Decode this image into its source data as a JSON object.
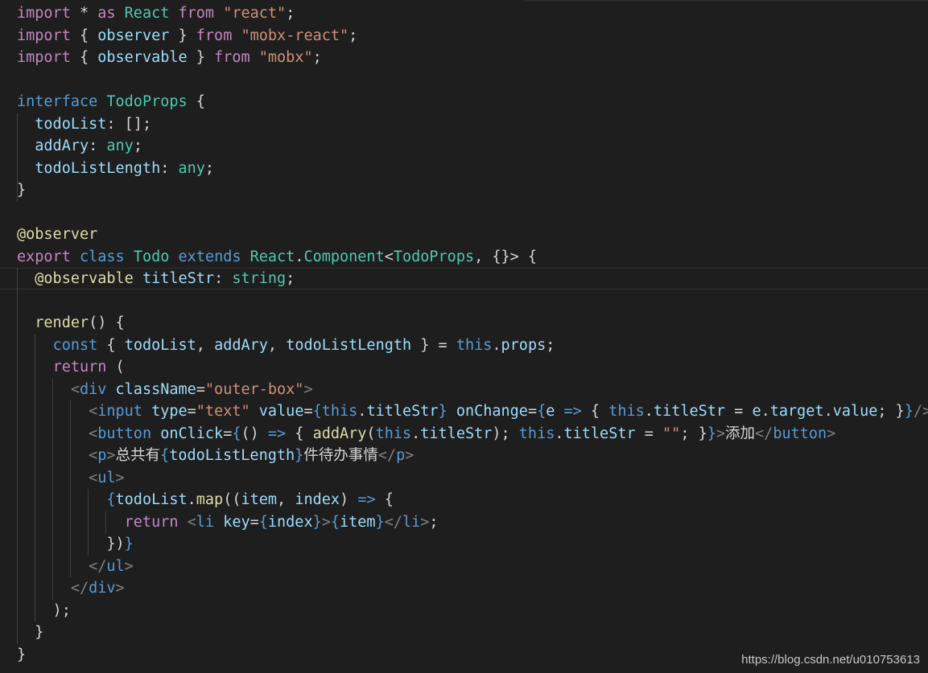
{
  "editor": {
    "theme": "dark",
    "colors": {
      "background": "#1e1e1e",
      "keyword": "#c586c0",
      "storage": "#569cd6",
      "type": "#4ec9b0",
      "string": "#ce9178",
      "variable": "#9cdcfe",
      "function": "#dcdcaa",
      "tag_bracket": "#808080"
    },
    "lines": [
      [
        [
          "kw",
          "import"
        ],
        [
          "pun",
          " * "
        ],
        [
          "kw",
          "as"
        ],
        [
          "pun",
          " "
        ],
        [
          "cls",
          "React"
        ],
        [
          "pun",
          " "
        ],
        [
          "kw",
          "from"
        ],
        [
          "pun",
          " "
        ],
        [
          "str",
          "\"react\""
        ],
        [
          "pun",
          ";"
        ]
      ],
      [
        [
          "kw",
          "import"
        ],
        [
          "pun",
          " { "
        ],
        [
          "var",
          "observer"
        ],
        [
          "pun",
          " } "
        ],
        [
          "kw",
          "from"
        ],
        [
          "pun",
          " "
        ],
        [
          "str",
          "\"mobx-react\""
        ],
        [
          "pun",
          ";"
        ]
      ],
      [
        [
          "kw",
          "import"
        ],
        [
          "pun",
          " { "
        ],
        [
          "var",
          "observable"
        ],
        [
          "pun",
          " } "
        ],
        [
          "kw",
          "from"
        ],
        [
          "pun",
          " "
        ],
        [
          "str",
          "\"mobx\""
        ],
        [
          "pun",
          ";"
        ]
      ],
      [],
      [
        [
          "bl",
          "interface"
        ],
        [
          "pun",
          " "
        ],
        [
          "cls",
          "TodoProps"
        ],
        [
          "pun",
          " {"
        ]
      ],
      [
        [
          "pun",
          "  "
        ],
        [
          "var",
          "todoList"
        ],
        [
          "pun",
          ": [];"
        ]
      ],
      [
        [
          "pun",
          "  "
        ],
        [
          "var",
          "addAry"
        ],
        [
          "pun",
          ": "
        ],
        [
          "cls",
          "any"
        ],
        [
          "pun",
          ";"
        ]
      ],
      [
        [
          "pun",
          "  "
        ],
        [
          "var",
          "todoListLength"
        ],
        [
          "pun",
          ": "
        ],
        [
          "cls",
          "any"
        ],
        [
          "pun",
          ";"
        ]
      ],
      [
        [
          "pun",
          "}"
        ]
      ],
      [],
      [
        [
          "fn",
          "@observer"
        ]
      ],
      [
        [
          "kw",
          "export"
        ],
        [
          "pun",
          " "
        ],
        [
          "bl",
          "class"
        ],
        [
          "pun",
          " "
        ],
        [
          "cls",
          "Todo"
        ],
        [
          "pun",
          " "
        ],
        [
          "bl",
          "extends"
        ],
        [
          "pun",
          " "
        ],
        [
          "cls",
          "React"
        ],
        [
          "pun",
          "."
        ],
        [
          "cls",
          "Component"
        ],
        [
          "pun",
          "<"
        ],
        [
          "cls",
          "TodoProps"
        ],
        [
          "pun",
          ", {}> {"
        ]
      ],
      [
        [
          "pun",
          "  "
        ],
        [
          "fn",
          "@observable"
        ],
        [
          "pun",
          " "
        ],
        [
          "var",
          "titleStr"
        ],
        [
          "pun",
          ": "
        ],
        [
          "cls",
          "string"
        ],
        [
          "pun",
          ";"
        ]
      ],
      [],
      [
        [
          "pun",
          "  "
        ],
        [
          "fn",
          "render"
        ],
        [
          "pun",
          "() {"
        ]
      ],
      [
        [
          "pun",
          "    "
        ],
        [
          "bl",
          "const"
        ],
        [
          "pun",
          " { "
        ],
        [
          "var",
          "todoList"
        ],
        [
          "pun",
          ", "
        ],
        [
          "var",
          "addAry"
        ],
        [
          "pun",
          ", "
        ],
        [
          "var",
          "todoListLength"
        ],
        [
          "pun",
          " } = "
        ],
        [
          "bl",
          "this"
        ],
        [
          "pun",
          "."
        ],
        [
          "var",
          "props"
        ],
        [
          "pun",
          ";"
        ]
      ],
      [
        [
          "pun",
          "    "
        ],
        [
          "kw",
          "return"
        ],
        [
          "pun",
          " ("
        ]
      ],
      [
        [
          "pun",
          "      "
        ],
        [
          "tag",
          "<"
        ],
        [
          "bl",
          "div"
        ],
        [
          "pun",
          " "
        ],
        [
          "var",
          "className"
        ],
        [
          "pun",
          "="
        ],
        [
          "str",
          "\"outer-box\""
        ],
        [
          "tag",
          ">"
        ]
      ],
      [
        [
          "pun",
          "        "
        ],
        [
          "tag",
          "<"
        ],
        [
          "bl",
          "input"
        ],
        [
          "pun",
          " "
        ],
        [
          "var",
          "type"
        ],
        [
          "pun",
          "="
        ],
        [
          "str",
          "\"text\""
        ],
        [
          "pun",
          " "
        ],
        [
          "var",
          "value"
        ],
        [
          "pun",
          "="
        ],
        [
          "brace",
          "{"
        ],
        [
          "bl",
          "this"
        ],
        [
          "pun",
          "."
        ],
        [
          "var",
          "titleStr"
        ],
        [
          "brace",
          "}"
        ],
        [
          "pun",
          " "
        ],
        [
          "var",
          "onChange"
        ],
        [
          "pun",
          "="
        ],
        [
          "brace",
          "{"
        ],
        [
          "var",
          "e"
        ],
        [
          "pun",
          " "
        ],
        [
          "bl",
          "=>"
        ],
        [
          "pun",
          " { "
        ],
        [
          "bl",
          "this"
        ],
        [
          "pun",
          "."
        ],
        [
          "var",
          "titleStr"
        ],
        [
          "pun",
          " = "
        ],
        [
          "var",
          "e"
        ],
        [
          "pun",
          "."
        ],
        [
          "var",
          "target"
        ],
        [
          "pun",
          "."
        ],
        [
          "var",
          "value"
        ],
        [
          "pun",
          "; }"
        ],
        [
          "brace",
          "}"
        ],
        [
          "tag",
          "/>"
        ]
      ],
      [
        [
          "pun",
          "        "
        ],
        [
          "tag",
          "<"
        ],
        [
          "bl",
          "button"
        ],
        [
          "pun",
          " "
        ],
        [
          "var",
          "onClick"
        ],
        [
          "pun",
          "="
        ],
        [
          "brace",
          "{"
        ],
        [
          "pun",
          "() "
        ],
        [
          "bl",
          "=>"
        ],
        [
          "pun",
          " { "
        ],
        [
          "fn",
          "addAry"
        ],
        [
          "pun",
          "("
        ],
        [
          "bl",
          "this"
        ],
        [
          "pun",
          "."
        ],
        [
          "var",
          "titleStr"
        ],
        [
          "pun",
          "); "
        ],
        [
          "bl",
          "this"
        ],
        [
          "pun",
          "."
        ],
        [
          "var",
          "titleStr"
        ],
        [
          "pun",
          " = "
        ],
        [
          "str",
          "\"\""
        ],
        [
          "pun",
          "; }"
        ],
        [
          "brace",
          "}"
        ],
        [
          "tag",
          ">"
        ],
        [
          "cn",
          "添加"
        ],
        [
          "tag",
          "</"
        ],
        [
          "bl",
          "button"
        ],
        [
          "tag",
          ">"
        ]
      ],
      [
        [
          "pun",
          "        "
        ],
        [
          "tag",
          "<"
        ],
        [
          "bl",
          "p"
        ],
        [
          "tag",
          ">"
        ],
        [
          "cn",
          "总共有"
        ],
        [
          "brace",
          "{"
        ],
        [
          "var",
          "todoListLength"
        ],
        [
          "brace",
          "}"
        ],
        [
          "cn",
          "件待办事情"
        ],
        [
          "tag",
          "</"
        ],
        [
          "bl",
          "p"
        ],
        [
          "tag",
          ">"
        ]
      ],
      [
        [
          "pun",
          "        "
        ],
        [
          "tag",
          "<"
        ],
        [
          "bl",
          "ul"
        ],
        [
          "tag",
          ">"
        ]
      ],
      [
        [
          "pun",
          "          "
        ],
        [
          "brace",
          "{"
        ],
        [
          "var",
          "todoList"
        ],
        [
          "pun",
          "."
        ],
        [
          "fn",
          "map"
        ],
        [
          "pun",
          "(("
        ],
        [
          "var",
          "item"
        ],
        [
          "pun",
          ", "
        ],
        [
          "var",
          "index"
        ],
        [
          "pun",
          ") "
        ],
        [
          "bl",
          "=>"
        ],
        [
          "pun",
          " {"
        ]
      ],
      [
        [
          "pun",
          "            "
        ],
        [
          "kw",
          "return"
        ],
        [
          "pun",
          " "
        ],
        [
          "tag",
          "<"
        ],
        [
          "bl",
          "li"
        ],
        [
          "pun",
          " "
        ],
        [
          "var",
          "key"
        ],
        [
          "pun",
          "="
        ],
        [
          "brace",
          "{"
        ],
        [
          "var",
          "index"
        ],
        [
          "brace",
          "}"
        ],
        [
          "tag",
          ">"
        ],
        [
          "brace",
          "{"
        ],
        [
          "var",
          "item"
        ],
        [
          "brace",
          "}"
        ],
        [
          "tag",
          "</"
        ],
        [
          "bl",
          "li"
        ],
        [
          "tag",
          ">"
        ],
        [
          "pun",
          ";"
        ]
      ],
      [
        [
          "pun",
          "          })"
        ],
        [
          "brace",
          "}"
        ]
      ],
      [
        [
          "pun",
          "        "
        ],
        [
          "tag",
          "</"
        ],
        [
          "bl",
          "ul"
        ],
        [
          "tag",
          ">"
        ]
      ],
      [
        [
          "pun",
          "      "
        ],
        [
          "tag",
          "</"
        ],
        [
          "bl",
          "div"
        ],
        [
          "tag",
          ">"
        ]
      ],
      [
        [
          "pun",
          "    );"
        ]
      ],
      [
        [
          "pun",
          "  }"
        ]
      ],
      [
        [
          "pun",
          "}"
        ]
      ]
    ]
  },
  "watermark": "https://blog.csdn.net/u010753613"
}
